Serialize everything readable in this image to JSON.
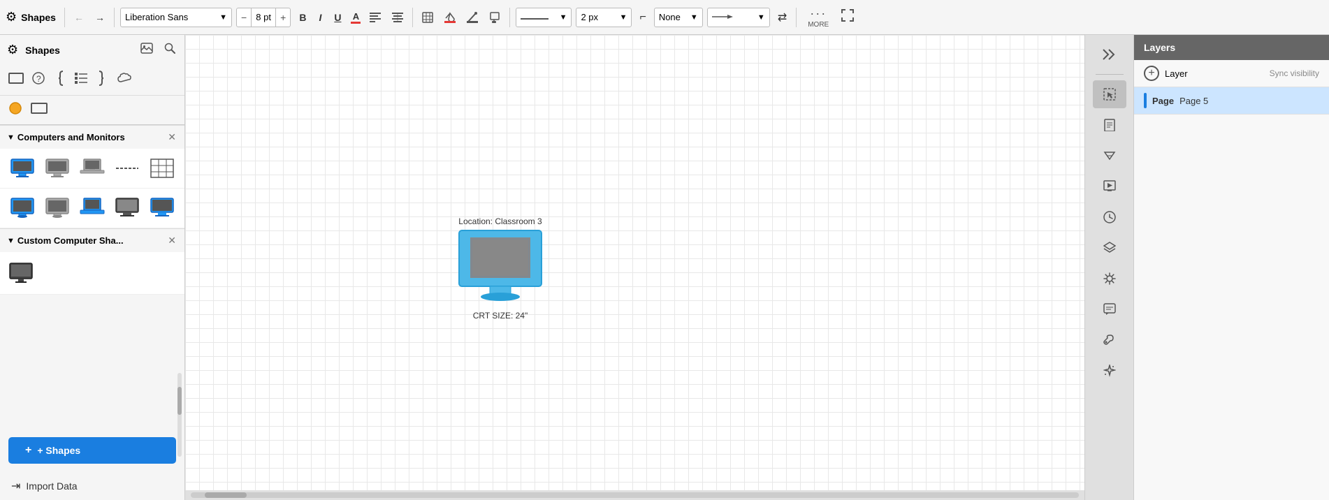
{
  "app": {
    "title": "Shapes"
  },
  "toolbar": {
    "font_family": "Liberation Sans",
    "font_size": "8 pt",
    "bold_label": "B",
    "italic_label": "I",
    "underline_label": "U",
    "font_color_label": "A",
    "align_label": "≡",
    "text_align_label": "≣",
    "table_icon": "⊞",
    "fill_icon": "◈",
    "line_color_icon": "✏",
    "format_icon": "❏",
    "line_style_label": "—",
    "line_width": "2 px",
    "waypoint_icon": "⌐",
    "connector_label": "None",
    "arrow_label": "→",
    "swap_icon": "⇄",
    "more_label": "MORE",
    "fullscreen_icon": "⤢"
  },
  "sidebar": {
    "title": "Shapes",
    "search_tooltip": "Search shapes",
    "image_tooltip": "Insert image",
    "sections": [
      {
        "id": "computers-monitors",
        "title": "Computers and Monitors",
        "shapes": [
          {
            "id": "desktop-blue",
            "label": "Desktop Blue"
          },
          {
            "id": "monitor-gray",
            "label": "Monitor Gray"
          },
          {
            "id": "laptop",
            "label": "Laptop"
          },
          {
            "id": "separator",
            "label": "Separator"
          },
          {
            "id": "grid",
            "label": "Grid"
          },
          {
            "id": "monitor-2",
            "label": "Monitor 2"
          },
          {
            "id": "monitor-3",
            "label": "Monitor 3"
          },
          {
            "id": "laptop-2",
            "label": "Laptop 2"
          },
          {
            "id": "monitor-4",
            "label": "Monitor 4"
          },
          {
            "id": "monitor-5",
            "label": "Monitor 5"
          }
        ]
      },
      {
        "id": "custom-computer",
        "title": "Custom Computer Sha...",
        "shapes": [
          {
            "id": "custom-monitor",
            "label": "Custom Monitor"
          }
        ]
      }
    ],
    "add_shapes_label": "+ Shapes",
    "import_data_label": "Import Data"
  },
  "canvas": {
    "shape": {
      "label_top": "Location: Classroom 3",
      "label_bottom": "CRT SIZE: 24\""
    }
  },
  "right_panel": {
    "icons": [
      {
        "id": "expand",
        "symbol": "≫"
      },
      {
        "id": "select",
        "symbol": "⬚"
      },
      {
        "id": "page",
        "symbol": "▤"
      },
      {
        "id": "quote",
        "symbol": "❝"
      },
      {
        "id": "presentation",
        "symbol": "▷"
      },
      {
        "id": "clock",
        "symbol": "○"
      },
      {
        "id": "layers",
        "symbol": "◨"
      },
      {
        "id": "theme",
        "symbol": "◈"
      },
      {
        "id": "comment",
        "symbol": "💬"
      },
      {
        "id": "paint",
        "symbol": "🖌"
      },
      {
        "id": "magic",
        "symbol": "✦"
      }
    ]
  },
  "layers_panel": {
    "title": "Layers",
    "layer": {
      "name": "Layer",
      "sync_label": "Sync visibility"
    },
    "page": {
      "label": "Page",
      "name": "Page 5"
    }
  }
}
